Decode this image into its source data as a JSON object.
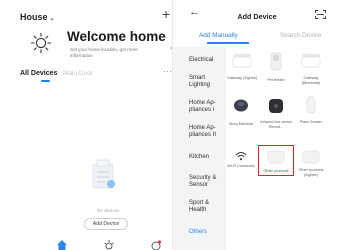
{
  "left_screen": {
    "home_title": "House",
    "home_chevron": "⌄",
    "add_icon": "plus-icon",
    "welcome": {
      "title": "Welcome home",
      "subtitle": "Set your home location, get more information",
      "icon": "sun-icon"
    },
    "tabs": [
      {
        "label": "All Devices",
        "selected": true
      },
      {
        "label": "Main Door",
        "selected": false
      }
    ],
    "more_label": "···",
    "empty_state": {
      "message": "No devices",
      "button_label": "Add Device"
    },
    "tabbar": [
      "home-icon",
      "smart-icon",
      "profile-icon"
    ]
  },
  "right_screen": {
    "back_label": "←",
    "title": "Add Device",
    "scan_icon": "scan-icon",
    "tabs": [
      {
        "label": "Add Manually",
        "selected": true
      },
      {
        "label": "Search Device",
        "selected": false
      }
    ],
    "categories": [
      {
        "label": "Electrical",
        "active": false
      },
      {
        "label": "Smart Lighting",
        "active": false
      },
      {
        "label": "Home Ap-pliances i",
        "active": false
      },
      {
        "label": "Home Ap-pliances II",
        "active": false
      },
      {
        "label": "Kitchen",
        "active": false
      },
      {
        "label": "Security & Sensor",
        "active": false
      },
      {
        "label": "Sport & Health",
        "active": false
      },
      {
        "label": "Others",
        "active": true
      }
    ],
    "devices": [
      {
        "label": "Gateway (Zigbee)",
        "icon": "gateway-icon"
      },
      {
        "label": "Pet feeder",
        "icon": "pet-feeder-icon"
      },
      {
        "label": "Gateway (Bluetooth)",
        "icon": "gateway-bluetooth-icon"
      },
      {
        "label": "Story Machine",
        "icon": "story-machine-icon"
      },
      {
        "label": "Infrared Uni-versal Remot...",
        "icon": "infrared-remote-icon"
      },
      {
        "label": "Plant Grower",
        "icon": "plant-grower-icon"
      },
      {
        "label": "Wi-Fi Connector",
        "icon": "wifi-connector-icon"
      },
      {
        "label": "Other products",
        "icon": "other-products-icon",
        "highlighted": true
      },
      {
        "label": "Other products (Zigbee)",
        "icon": "other-products-zigbee-icon"
      }
    ],
    "colors": {
      "accent": "#2a86ec",
      "highlight": "#e02424",
      "category_bg": "#f3f4f6"
    }
  }
}
